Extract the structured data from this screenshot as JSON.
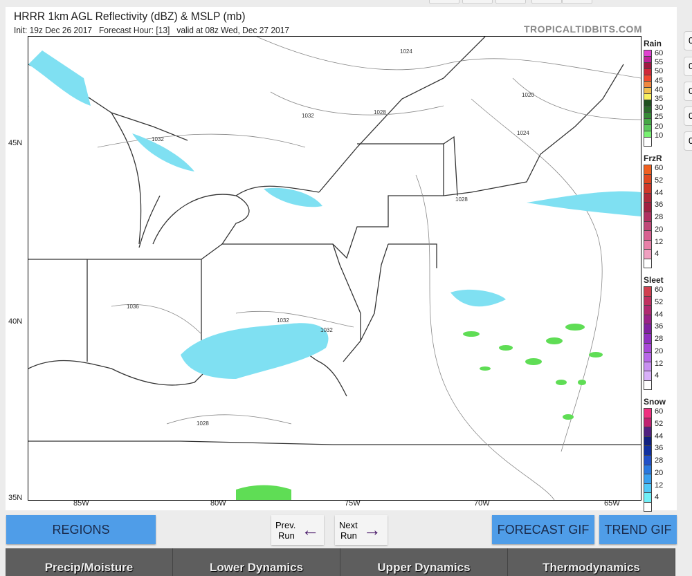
{
  "header": {
    "title": "HRRR 1km AGL Reflectivity (dBZ) & MSLP (mb)",
    "subtitle": "Init: 19z Dec 26 2017   Forecast Hour: [13]   valid at 08z Wed, Dec 27 2017",
    "brand": "TROPICALTIDBITS.COM"
  },
  "map": {
    "lat_labels": [
      "45N",
      "40N",
      "35N"
    ],
    "lon_labels": [
      "85W",
      "80W",
      "75W",
      "70W",
      "65W"
    ],
    "isobars": [
      "1024",
      "1020",
      "1032",
      "1028",
      "1024",
      "1032",
      "1028",
      "1036",
      "1032",
      "1032",
      "1028"
    ]
  },
  "legend": {
    "rain": {
      "title": "Rain",
      "labels": [
        "60",
        "55",
        "50",
        "45",
        "40",
        "35",
        "30",
        "25",
        "20",
        "10"
      ],
      "colors": [
        "#e040d0",
        "#c0209a",
        "#a01840",
        "#d02838",
        "#f04830",
        "#f08840",
        "#f0c050",
        "#f8f060",
        "#205020",
        "#2a6a2a",
        "#358a35",
        "#45a845",
        "#5cc85c",
        "#78f070"
      ]
    },
    "frzr": {
      "title": "FrzR",
      "labels": [
        "60",
        "52",
        "44",
        "36",
        "28",
        "20",
        "12",
        "4"
      ],
      "colors": [
        "#f06020",
        "#e04820",
        "#d03828",
        "#b02838",
        "#a02040",
        "#b03060",
        "#c04878",
        "#d86090",
        "#e880a8",
        "#f0a0c0"
      ]
    },
    "sleet": {
      "title": "Sleet",
      "labels": [
        "60",
        "52",
        "44",
        "36",
        "28",
        "20",
        "12",
        "4"
      ],
      "colors": [
        "#d04050",
        "#c03060",
        "#b02870",
        "#9a2088",
        "#8020a0",
        "#9030c0",
        "#a848d8",
        "#b868e8",
        "#c890f0",
        "#d8b0f8"
      ]
    },
    "snow": {
      "title": "Snow",
      "labels": [
        "60",
        "52",
        "44",
        "36",
        "28",
        "20",
        "12",
        "4"
      ],
      "colors": [
        "#f03080",
        "#c02070",
        "#502080",
        "#102080",
        "#1030a0",
        "#2050c8",
        "#2878e0",
        "#38a0f0",
        "#50c8f8",
        "#70f0f8"
      ]
    }
  },
  "side_buttons": [
    "0",
    "0",
    "0",
    "0",
    "0"
  ],
  "controls": {
    "regions": "REGIONS",
    "prev_top": "Prev.",
    "prev_bottom": "Run",
    "next_top": "Next",
    "next_bottom": "Run",
    "forecast_gif": "FORECAST GIF",
    "trend_gif": "TREND GIF"
  },
  "tabs": [
    "Precip/Moisture",
    "Lower Dynamics",
    "Upper Dynamics",
    "Thermodynamics"
  ]
}
